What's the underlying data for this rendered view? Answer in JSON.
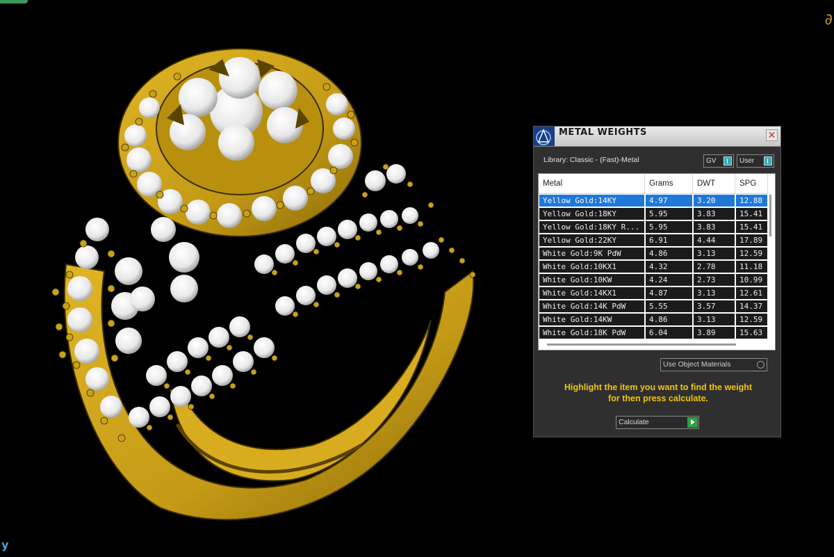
{
  "panel": {
    "title": "METAL WEIGHTS",
    "close_label": "✕",
    "library_label": "Library: Classic - (Fast)-Metal",
    "toggles": [
      {
        "label": "GV"
      },
      {
        "label": "User"
      }
    ],
    "table": {
      "columns": [
        "Metal",
        "Grams",
        "DWT",
        "SPG"
      ],
      "rows": [
        {
          "metal": "Yellow Gold:14KY",
          "grams": "4.97",
          "dwt": "3.20",
          "spg": "12.88"
        },
        {
          "metal": "Yellow Gold:18KY",
          "grams": "5.95",
          "dwt": "3.83",
          "spg": "15.41"
        },
        {
          "metal": "Yellow Gold:18KY R...",
          "grams": "5.95",
          "dwt": "3.83",
          "spg": "15.41"
        },
        {
          "metal": "Yellow Gold:22KY",
          "grams": "6.91",
          "dwt": "4.44",
          "spg": "17.89"
        },
        {
          "metal": "White Gold:9K PdW",
          "grams": "4.86",
          "dwt": "3.13",
          "spg": "12.59"
        },
        {
          "metal": "White Gold:10KX1",
          "grams": "4.32",
          "dwt": "2.78",
          "spg": "11.18"
        },
        {
          "metal": "White Gold:10KW",
          "grams": "4.24",
          "dwt": "2.73",
          "spg": "10.99"
        },
        {
          "metal": "White Gold:14KX1",
          "grams": "4.87",
          "dwt": "3.13",
          "spg": "12.61"
        },
        {
          "metal": "White Gold:14K PdW",
          "grams": "5.55",
          "dwt": "3.57",
          "spg": "14.37"
        },
        {
          "metal": "White Gold:14KW",
          "grams": "4.86",
          "dwt": "3.13",
          "spg": "12.59"
        },
        {
          "metal": "White Gold:18K PdW",
          "grams": "6.04",
          "dwt": "3.89",
          "spg": "15.63"
        }
      ]
    },
    "material_dropdown": "Use Object Materials",
    "instruction_line1": "Highlight the item you want to find the weight",
    "instruction_line2": "for then press calculate.",
    "calculate_label": "Calculate"
  },
  "colors": {
    "gold": "#c9a21b",
    "selection": "#1f78d8",
    "instruction": "#f1c40f"
  }
}
